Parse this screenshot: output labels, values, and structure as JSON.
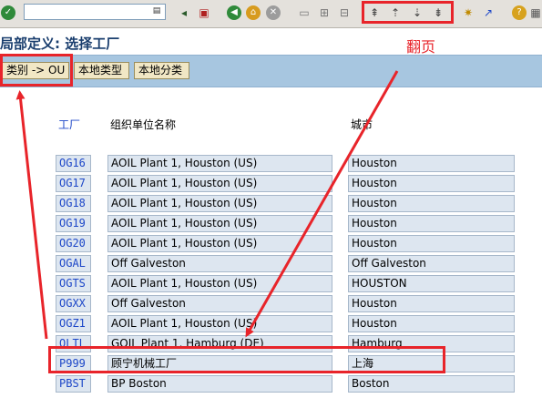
{
  "title": "局部定义: 选择工厂",
  "toolbar": {
    "command_value": "",
    "icons": [
      "check-icon",
      "back-icon",
      "exit-icon",
      "cancel-icon",
      "print-icon",
      "find-icon",
      "find-next-icon",
      "first-page-icon",
      "prev-page-icon",
      "next-page-icon",
      "last-page-icon",
      "new-session-icon",
      "shortcut-icon",
      "help-icon",
      "layout-icon"
    ]
  },
  "app_toolbar": {
    "buttons": [
      "类别 -> OU",
      "本地类型",
      "本地分类"
    ]
  },
  "table": {
    "headers": {
      "code": "工厂",
      "name": "组织单位名称",
      "city": "城市"
    },
    "rows": [
      {
        "code": "OG16",
        "name": "AOIL Plant 1, Houston (US)",
        "city": "Houston"
      },
      {
        "code": "OG17",
        "name": "AOIL Plant 1, Houston (US)",
        "city": "Houston"
      },
      {
        "code": "OG18",
        "name": "AOIL Plant 1, Houston (US)",
        "city": "Houston"
      },
      {
        "code": "OG19",
        "name": "AOIL Plant 1, Houston (US)",
        "city": "Houston"
      },
      {
        "code": "OG20",
        "name": "AOIL Plant 1, Houston (US)",
        "city": "Houston"
      },
      {
        "code": "OGAL",
        "name": "Off Galveston",
        "city": "Off Galveston"
      },
      {
        "code": "OGTS",
        "name": "AOIL Plant 1, Houston (US)",
        "city": "HOUSTON"
      },
      {
        "code": "OGXX",
        "name": "Off Galveston",
        "city": "Houston"
      },
      {
        "code": "OGZ1",
        "name": "AOIL Plant 1, Houston (US)",
        "city": "Houston"
      },
      {
        "code": "OLTL",
        "name": "GOIL Plant 1, Hamburg (DE)",
        "city": "Hamburg"
      },
      {
        "code": "P999",
        "name": "顾宁机械工厂",
        "city": "上海"
      },
      {
        "code": "PBST",
        "name": "BP Boston",
        "city": "Boston"
      }
    ]
  },
  "annotation": {
    "label": "翻页",
    "color": "#e8242a"
  }
}
